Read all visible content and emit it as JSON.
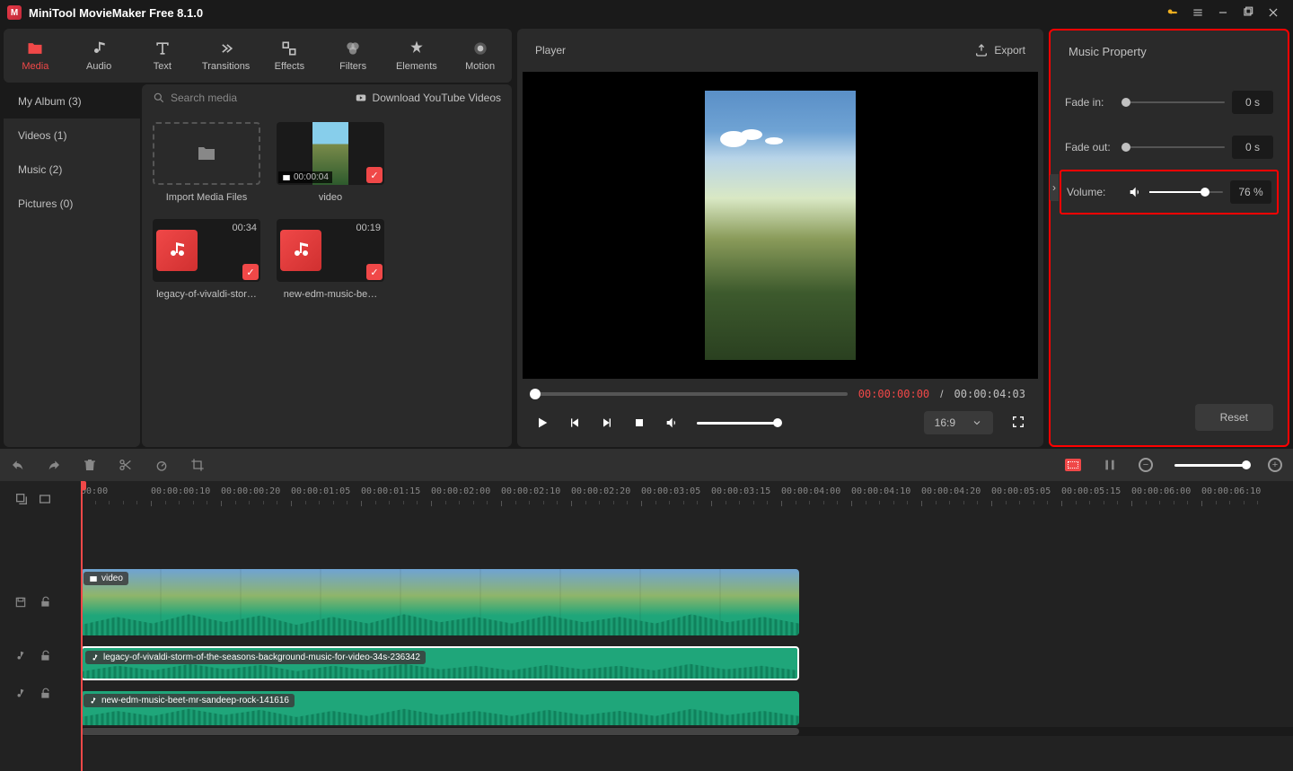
{
  "app": {
    "title": "MiniTool MovieMaker Free 8.1.0"
  },
  "tabs": [
    {
      "label": "Media"
    },
    {
      "label": "Audio"
    },
    {
      "label": "Text"
    },
    {
      "label": "Transitions"
    },
    {
      "label": "Effects"
    },
    {
      "label": "Filters"
    },
    {
      "label": "Elements"
    },
    {
      "label": "Motion"
    }
  ],
  "album": {
    "items": [
      {
        "label": "My Album (3)"
      },
      {
        "label": "Videos (1)"
      },
      {
        "label": "Music (2)"
      },
      {
        "label": "Pictures (0)"
      }
    ]
  },
  "media": {
    "search_placeholder": "Search media",
    "download_label": "Download YouTube Videos",
    "import_label": "Import Media Files",
    "items": [
      {
        "name": "video",
        "duration": "00:00:04"
      },
      {
        "name": "legacy-of-vivaldi-stor…",
        "duration": "00:34"
      },
      {
        "name": "new-edm-music-be…",
        "duration": "00:19"
      }
    ]
  },
  "player": {
    "title": "Player",
    "export_label": "Export",
    "time_current": "00:00:00:00",
    "time_total": "00:00:04:03",
    "aspect": "16:9"
  },
  "props": {
    "title": "Music Property",
    "fade_in": {
      "label": "Fade in:",
      "value": "0 s"
    },
    "fade_out": {
      "label": "Fade out:",
      "value": "0 s"
    },
    "volume": {
      "label": "Volume:",
      "value": "76 %",
      "pct": 76
    },
    "reset": "Reset"
  },
  "ruler": [
    "00:00",
    "00:00:00:10",
    "00:00:00:20",
    "00:00:01:05",
    "00:00:01:15",
    "00:00:02:00",
    "00:00:02:10",
    "00:00:02:20",
    "00:00:03:05",
    "00:00:03:15",
    "00:00:04:00",
    "00:00:04:10",
    "00:00:04:20",
    "00:00:05:05",
    "00:00:05:15",
    "00:00:06:00",
    "00:00:06:10"
  ],
  "clips": {
    "video": {
      "label": "video"
    },
    "audio1": {
      "label": "legacy-of-vivaldi-storm-of-the-seasons-background-music-for-video-34s-236342"
    },
    "audio2": {
      "label": "new-edm-music-beet-mr-sandeep-rock-141616"
    }
  }
}
